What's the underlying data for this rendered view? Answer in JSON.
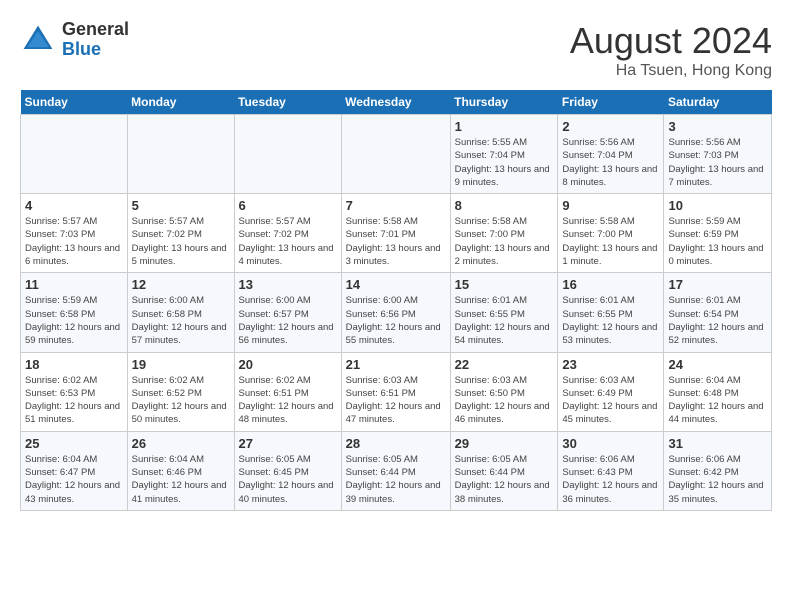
{
  "logo": {
    "general": "General",
    "blue": "Blue"
  },
  "title": "August 2024",
  "location": "Ha Tsuen, Hong Kong",
  "days_of_week": [
    "Sunday",
    "Monday",
    "Tuesday",
    "Wednesday",
    "Thursday",
    "Friday",
    "Saturday"
  ],
  "weeks": [
    [
      {
        "day": "",
        "info": ""
      },
      {
        "day": "",
        "info": ""
      },
      {
        "day": "",
        "info": ""
      },
      {
        "day": "",
        "info": ""
      },
      {
        "day": "1",
        "info": "Sunrise: 5:55 AM\nSunset: 7:04 PM\nDaylight: 13 hours\nand 9 minutes."
      },
      {
        "day": "2",
        "info": "Sunrise: 5:56 AM\nSunset: 7:04 PM\nDaylight: 13 hours\nand 8 minutes."
      },
      {
        "day": "3",
        "info": "Sunrise: 5:56 AM\nSunset: 7:03 PM\nDaylight: 13 hours\nand 7 minutes."
      }
    ],
    [
      {
        "day": "4",
        "info": "Sunrise: 5:57 AM\nSunset: 7:03 PM\nDaylight: 13 hours\nand 6 minutes."
      },
      {
        "day": "5",
        "info": "Sunrise: 5:57 AM\nSunset: 7:02 PM\nDaylight: 13 hours\nand 5 minutes."
      },
      {
        "day": "6",
        "info": "Sunrise: 5:57 AM\nSunset: 7:02 PM\nDaylight: 13 hours\nand 4 minutes."
      },
      {
        "day": "7",
        "info": "Sunrise: 5:58 AM\nSunset: 7:01 PM\nDaylight: 13 hours\nand 3 minutes."
      },
      {
        "day": "8",
        "info": "Sunrise: 5:58 AM\nSunset: 7:00 PM\nDaylight: 13 hours\nand 2 minutes."
      },
      {
        "day": "9",
        "info": "Sunrise: 5:58 AM\nSunset: 7:00 PM\nDaylight: 13 hours\nand 1 minute."
      },
      {
        "day": "10",
        "info": "Sunrise: 5:59 AM\nSunset: 6:59 PM\nDaylight: 13 hours\nand 0 minutes."
      }
    ],
    [
      {
        "day": "11",
        "info": "Sunrise: 5:59 AM\nSunset: 6:58 PM\nDaylight: 12 hours\nand 59 minutes."
      },
      {
        "day": "12",
        "info": "Sunrise: 6:00 AM\nSunset: 6:58 PM\nDaylight: 12 hours\nand 57 minutes."
      },
      {
        "day": "13",
        "info": "Sunrise: 6:00 AM\nSunset: 6:57 PM\nDaylight: 12 hours\nand 56 minutes."
      },
      {
        "day": "14",
        "info": "Sunrise: 6:00 AM\nSunset: 6:56 PM\nDaylight: 12 hours\nand 55 minutes."
      },
      {
        "day": "15",
        "info": "Sunrise: 6:01 AM\nSunset: 6:55 PM\nDaylight: 12 hours\nand 54 minutes."
      },
      {
        "day": "16",
        "info": "Sunrise: 6:01 AM\nSunset: 6:55 PM\nDaylight: 12 hours\nand 53 minutes."
      },
      {
        "day": "17",
        "info": "Sunrise: 6:01 AM\nSunset: 6:54 PM\nDaylight: 12 hours\nand 52 minutes."
      }
    ],
    [
      {
        "day": "18",
        "info": "Sunrise: 6:02 AM\nSunset: 6:53 PM\nDaylight: 12 hours\nand 51 minutes."
      },
      {
        "day": "19",
        "info": "Sunrise: 6:02 AM\nSunset: 6:52 PM\nDaylight: 12 hours\nand 50 minutes."
      },
      {
        "day": "20",
        "info": "Sunrise: 6:02 AM\nSunset: 6:51 PM\nDaylight: 12 hours\nand 48 minutes."
      },
      {
        "day": "21",
        "info": "Sunrise: 6:03 AM\nSunset: 6:51 PM\nDaylight: 12 hours\nand 47 minutes."
      },
      {
        "day": "22",
        "info": "Sunrise: 6:03 AM\nSunset: 6:50 PM\nDaylight: 12 hours\nand 46 minutes."
      },
      {
        "day": "23",
        "info": "Sunrise: 6:03 AM\nSunset: 6:49 PM\nDaylight: 12 hours\nand 45 minutes."
      },
      {
        "day": "24",
        "info": "Sunrise: 6:04 AM\nSunset: 6:48 PM\nDaylight: 12 hours\nand 44 minutes."
      }
    ],
    [
      {
        "day": "25",
        "info": "Sunrise: 6:04 AM\nSunset: 6:47 PM\nDaylight: 12 hours\nand 43 minutes."
      },
      {
        "day": "26",
        "info": "Sunrise: 6:04 AM\nSunset: 6:46 PM\nDaylight: 12 hours\nand 41 minutes."
      },
      {
        "day": "27",
        "info": "Sunrise: 6:05 AM\nSunset: 6:45 PM\nDaylight: 12 hours\nand 40 minutes."
      },
      {
        "day": "28",
        "info": "Sunrise: 6:05 AM\nSunset: 6:44 PM\nDaylight: 12 hours\nand 39 minutes."
      },
      {
        "day": "29",
        "info": "Sunrise: 6:05 AM\nSunset: 6:44 PM\nDaylight: 12 hours\nand 38 minutes."
      },
      {
        "day": "30",
        "info": "Sunrise: 6:06 AM\nSunset: 6:43 PM\nDaylight: 12 hours\nand 36 minutes."
      },
      {
        "day": "31",
        "info": "Sunrise: 6:06 AM\nSunset: 6:42 PM\nDaylight: 12 hours\nand 35 minutes."
      }
    ]
  ]
}
